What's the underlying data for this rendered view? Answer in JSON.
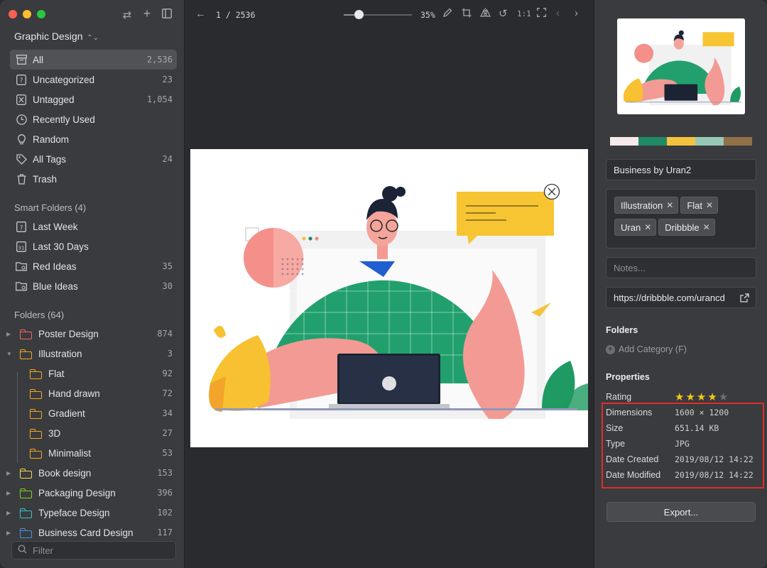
{
  "sidebar": {
    "library": "Graphic Design",
    "items": [
      {
        "label": "All",
        "count": "2,536",
        "icon": "archive-icon"
      },
      {
        "label": "Uncategorized",
        "count": "23",
        "icon": "question-file-icon"
      },
      {
        "label": "Untagged",
        "count": "1,054",
        "icon": "untagged-icon"
      },
      {
        "label": "Recently Used",
        "count": "",
        "icon": "clock-icon"
      },
      {
        "label": "Random",
        "count": "",
        "icon": "lightbulb-icon"
      },
      {
        "label": "All Tags",
        "count": "24",
        "icon": "tag-icon"
      },
      {
        "label": "Trash",
        "count": "",
        "icon": "trash-icon"
      }
    ],
    "smart_header": "Smart Folders (4)",
    "smart": [
      {
        "label": "Last Week",
        "count": "",
        "icon": "calendar-7-icon"
      },
      {
        "label": "Last 30 Days",
        "count": "",
        "icon": "calendar-31-icon"
      },
      {
        "label": "Red Ideas",
        "count": "35",
        "icon": "smart-folder-icon"
      },
      {
        "label": "Blue Ideas",
        "count": "30",
        "icon": "smart-folder-icon"
      }
    ],
    "folders_header": "Folders (64)",
    "folders": [
      {
        "label": "Poster Design",
        "count": "874",
        "color": "#f2655c"
      },
      {
        "label": "Illustration",
        "count": "3",
        "color": "#f5a623"
      },
      {
        "label": "Flat",
        "count": "92",
        "color": "#f5a623"
      },
      {
        "label": "Hand drawn",
        "count": "72",
        "color": "#f5a623"
      },
      {
        "label": "Gradient",
        "count": "34",
        "color": "#f5a623"
      },
      {
        "label": "3D",
        "count": "27",
        "color": "#f5a623"
      },
      {
        "label": "Minimalist",
        "count": "53",
        "color": "#f5a623"
      },
      {
        "label": "Book design",
        "count": "153",
        "color": "#f2d94e"
      },
      {
        "label": "Packaging Design",
        "count": "396",
        "color": "#7ed321"
      },
      {
        "label": "Typeface Design",
        "count": "102",
        "color": "#3ec6c6"
      },
      {
        "label": "Business Card Design",
        "count": "117",
        "color": "#4a90e2"
      }
    ],
    "filter_placeholder": "Filter"
  },
  "viewer": {
    "counter": "1 / 2536",
    "zoom": "35%",
    "one_to_one": "1:1"
  },
  "details": {
    "palette": [
      "#f8e9ea",
      "#1e8a66",
      "#f4c33e",
      "#97c9b9",
      "#917146"
    ],
    "title": "Business by Uran2",
    "tags": [
      "Illustration",
      "Flat",
      "Uran",
      "Dribbble"
    ],
    "notes_placeholder": "Notes...",
    "url": "https://dribbble.com/urancd",
    "folders_header": "Folders",
    "add_category": "Add Category (F)",
    "properties_header": "Properties",
    "rating_label": "Rating",
    "rating": 4,
    "rating_max": 5,
    "props": [
      {
        "k": "Dimensions",
        "v": "1600 × 1200"
      },
      {
        "k": "Size",
        "v": "651.14 KB"
      },
      {
        "k": "Type",
        "v": "JPG"
      },
      {
        "k": "Date Created",
        "v": "2019/08/12 14:22"
      },
      {
        "k": "Date Modified",
        "v": "2019/08/12 14:22"
      }
    ],
    "export_label": "Export..."
  },
  "colors": {
    "highlight_box": "#e02d2d",
    "star": "#f5c518"
  }
}
